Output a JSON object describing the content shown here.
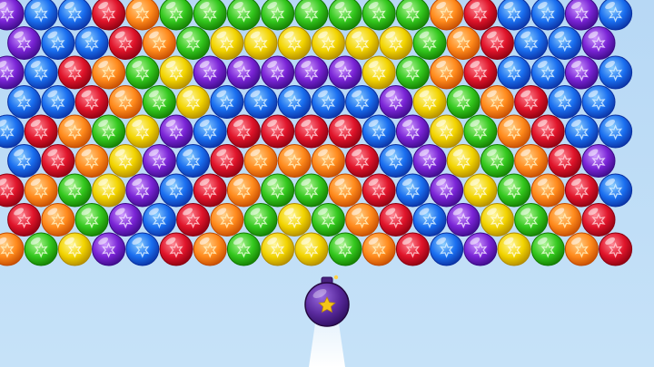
{
  "palette": {
    "R": {
      "name": "red",
      "main": "#e0142a",
      "light": "#ff8a96",
      "dark": "#8a0010",
      "star": "#ffd0d6"
    },
    "O": {
      "name": "orange",
      "main": "#ff8a1c",
      "light": "#ffd08a",
      "dark": "#c24a00",
      "star": "#fff0c0"
    },
    "Y": {
      "name": "yellow",
      "main": "#f2d400",
      "light": "#fff7a0",
      "dark": "#b08a00",
      "star": "#fffbe0"
    },
    "G": {
      "name": "green",
      "main": "#34c81e",
      "light": "#b4f59a",
      "dark": "#137a00",
      "star": "#e8ffd8"
    },
    "B": {
      "name": "blue",
      "main": "#1a6ff0",
      "light": "#8fd0ff",
      "dark": "#0a2fa0",
      "star": "#d8f0ff"
    },
    "P": {
      "name": "purple",
      "main": "#7a24d6",
      "light": "#cf9cff",
      "dark": "#3b0a86",
      "star": "#f0e0ff"
    }
  },
  "background": "#bcdcf6",
  "bubble_grid": {
    "rows": [
      [
        "P",
        "B",
        "B",
        "R",
        "O",
        "G",
        "G",
        "G",
        "G",
        "G",
        "G",
        "G",
        "G",
        "O",
        "R",
        "B",
        "B",
        "P",
        "B"
      ],
      [
        "P",
        "B",
        "B",
        "R",
        "O",
        "G",
        "Y",
        "Y",
        "Y",
        "Y",
        "Y",
        "Y",
        "G",
        "O",
        "R",
        "B",
        "B",
        "P"
      ],
      [
        "P",
        "B",
        "R",
        "O",
        "G",
        "Y",
        "P",
        "P",
        "P",
        "P",
        "P",
        "Y",
        "G",
        "O",
        "R",
        "B",
        "B",
        "P",
        "B"
      ],
      [
        "B",
        "B",
        "R",
        "O",
        "G",
        "Y",
        "B",
        "B",
        "B",
        "B",
        "B",
        "P",
        "Y",
        "G",
        "O",
        "R",
        "B",
        "B"
      ],
      [
        "B",
        "R",
        "O",
        "G",
        "Y",
        "P",
        "B",
        "R",
        "R",
        "R",
        "R",
        "B",
        "P",
        "Y",
        "G",
        "O",
        "R",
        "B",
        "B"
      ],
      [
        "B",
        "R",
        "O",
        "Y",
        "P",
        "B",
        "R",
        "O",
        "O",
        "O",
        "R",
        "B",
        "P",
        "Y",
        "G",
        "O",
        "R",
        "P"
      ],
      [
        "R",
        "O",
        "G",
        "Y",
        "P",
        "B",
        "R",
        "O",
        "G",
        "G",
        "O",
        "R",
        "B",
        "P",
        "Y",
        "G",
        "O",
        "R",
        "B"
      ],
      [
        "R",
        "O",
        "G",
        "P",
        "B",
        "R",
        "O",
        "G",
        "Y",
        "G",
        "O",
        "R",
        "B",
        "P",
        "Y",
        "G",
        "O",
        "R"
      ],
      [
        "O",
        "G",
        "Y",
        "P",
        "B",
        "R",
        "O",
        "G",
        "Y",
        "Y",
        "G",
        "O",
        "R",
        "B",
        "P",
        "Y",
        "G",
        "O",
        "R"
      ]
    ]
  },
  "shooter": {
    "type": "bomb",
    "body_color": "#5a2a9e",
    "star_color": "#f5c518",
    "icon": "star-icon"
  }
}
